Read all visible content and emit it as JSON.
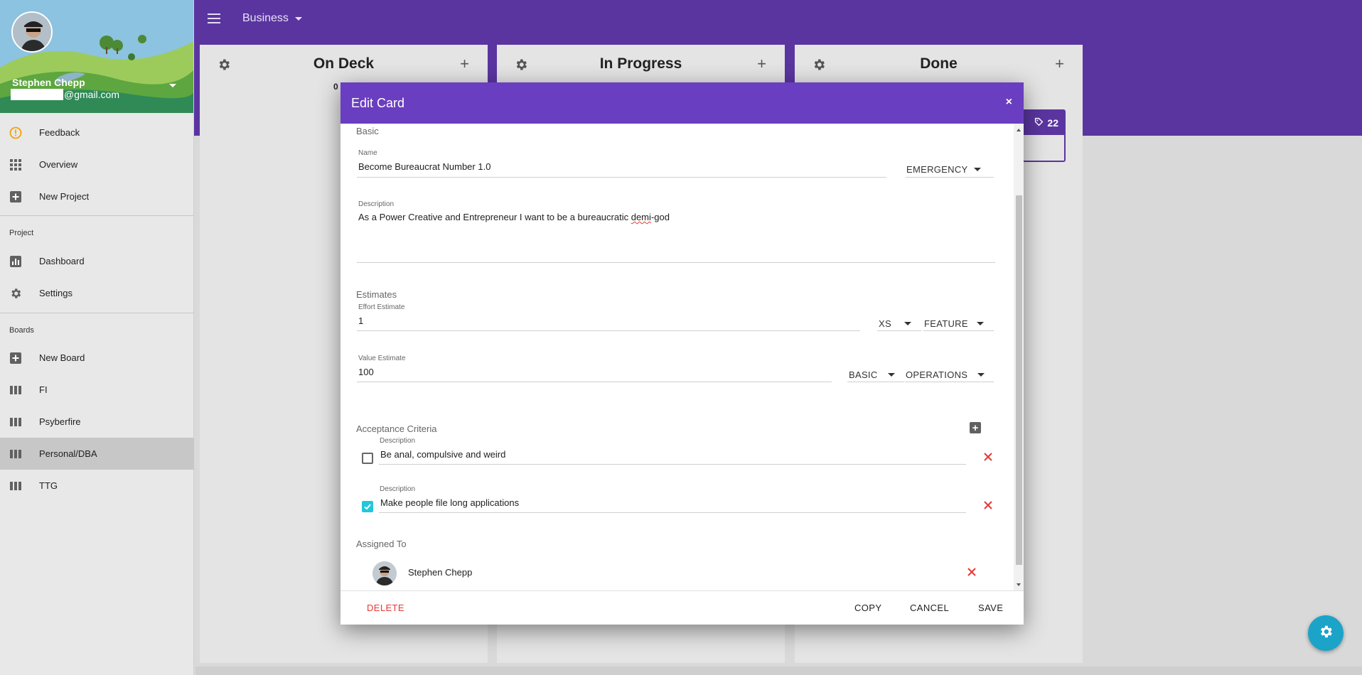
{
  "sidebar": {
    "user": {
      "name": "Stephen Chepp",
      "email_suffix": "@gmail.com"
    },
    "top_items": [
      {
        "label": "Feedback",
        "icon": "alert-circle-icon"
      },
      {
        "label": "Overview",
        "icon": "apps-grid-icon"
      },
      {
        "label": "New Project",
        "icon": "add-box-icon"
      }
    ],
    "project_section": "Project",
    "project_items": [
      {
        "label": "Dashboard",
        "icon": "bar-chart-icon"
      },
      {
        "label": "Settings",
        "icon": "gear-icon"
      }
    ],
    "boards_section": "Boards",
    "board_items": [
      {
        "label": "New Board",
        "icon": "add-box-icon"
      },
      {
        "label": "FI",
        "icon": "board-columns-icon"
      },
      {
        "label": "Psyberfire",
        "icon": "board-columns-icon"
      },
      {
        "label": "Personal/DBA",
        "icon": "board-columns-icon",
        "active": true
      },
      {
        "label": "TTG",
        "icon": "board-columns-icon"
      }
    ]
  },
  "appbar": {
    "project": "Business"
  },
  "columns": [
    {
      "title": "On Deck",
      "count": "0"
    },
    {
      "title": "In Progress"
    },
    {
      "title": "Done"
    }
  ],
  "card_peek": {
    "points": "22"
  },
  "modal": {
    "title": "Edit Card",
    "close": "×",
    "basic": {
      "section": "Basic",
      "name_label": "Name",
      "name_value": "Become Bureaucrat Number 1.0",
      "priority": "EMERGENCY",
      "description_label": "Description",
      "description_before": "As a Power Creative and Entrepreneur I want to be a bureaucratic ",
      "description_misspelled": "demi",
      "description_after": "-god"
    },
    "estimates": {
      "section": "Estimates",
      "effort_label": "Effort Estimate",
      "effort_value": "1",
      "size": "XS",
      "type": "FEATURE",
      "value_label": "Value Estimate",
      "value_value": "100",
      "value_level": "BASIC",
      "value_area": "OPERATIONS"
    },
    "acceptance": {
      "section": "Acceptance Criteria",
      "items": [
        {
          "label": "Description",
          "text": "Be anal, compulsive and weird",
          "checked": false
        },
        {
          "label": "Description",
          "text": "Make people file long applications",
          "checked": true
        }
      ]
    },
    "assigned": {
      "section": "Assigned To",
      "user": "Stephen Chepp"
    },
    "footer": {
      "delete": "DELETE",
      "copy": "COPY",
      "cancel": "CANCEL",
      "save": "SAVE"
    }
  },
  "colors": {
    "appbar": "#5a35a0",
    "modal_header": "#6a3ec0",
    "danger": "#e53935",
    "accent": "#26c6da",
    "fab": "#1ba4c8",
    "feedback_icon": "#f0a30a"
  }
}
